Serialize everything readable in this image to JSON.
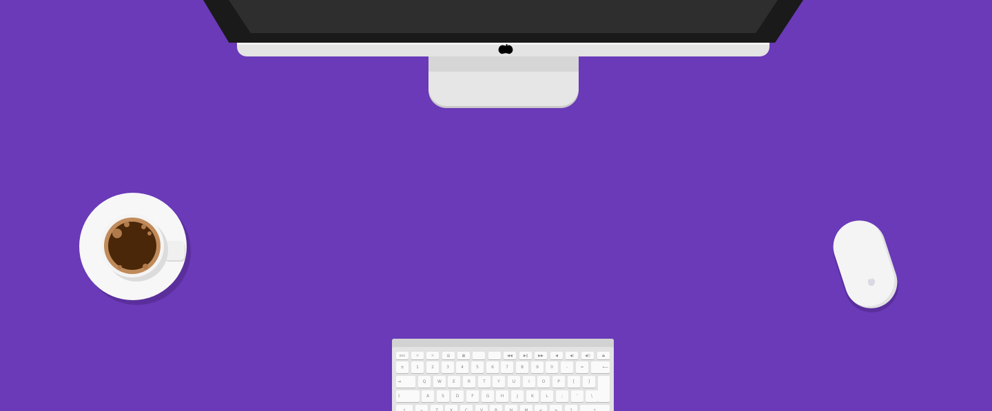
{
  "keyboard": {
    "fn_row": [
      "esc",
      "☼",
      "☼",
      "▤",
      "▦",
      "",
      "",
      "◀◀",
      "▶‖",
      "▶▶",
      "◀",
      "◀)",
      "◀))",
      "⏏"
    ],
    "number_row": [
      "±",
      "1",
      "2",
      "3",
      "4",
      "5",
      "6",
      "7",
      "8",
      "9",
      "0",
      "-",
      "=",
      "⟵"
    ],
    "qwerty_row": [
      "⇥",
      "Q",
      "W",
      "E",
      "R",
      "T",
      "Y",
      "U",
      "I",
      "O",
      "P",
      "[",
      "]"
    ],
    "home_row": [
      "⇪",
      "A",
      "S",
      "D",
      "F",
      "G",
      "H",
      "J",
      "K",
      "L",
      ";",
      "'",
      "\\"
    ],
    "bottom_row": [
      "⇧",
      "~",
      "Z",
      "X",
      "C",
      "V",
      "B",
      "N",
      "M",
      "<",
      ">",
      "?",
      "⇧"
    ]
  },
  "colors": {
    "background": "#6a3ab8",
    "monitor_bezel": "#1a1a1a",
    "aluminum": "#e4e4e4",
    "coffee": "#4a2709"
  }
}
